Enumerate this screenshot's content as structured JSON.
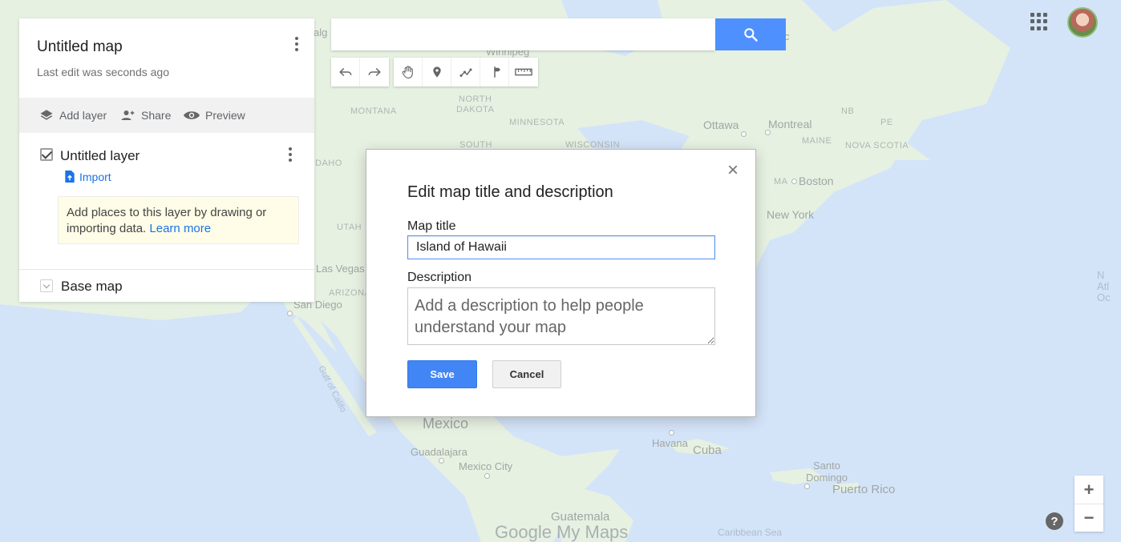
{
  "map": {
    "labels": {
      "winnipeg": "Winnipeg",
      "montana": "MONTANA",
      "north_dakota": "NORTH\nDAKOTA",
      "minnesota": "MINNESOTA",
      "south": "SOUTH",
      "wisconsin": "WISCONSIN",
      "idaho": "DAHO",
      "utah": "UTAH",
      "las_vegas": "Las Vegas",
      "arizona": "ARIZONA",
      "san_diego": "San Diego",
      "gulf_of_california": "Gulf of Califo",
      "mexico": "Mexico",
      "guadalajara": "Guadalajara",
      "mexico_city": "Mexico City",
      "guatemala": "Guatemala",
      "havana": "Havana",
      "cuba": "Cuba",
      "santo_domingo": "Santo\nDomingo",
      "puerto_rico": "Puerto Rico",
      "caribbean_sea": "Caribbean Sea",
      "ottawa": "Ottawa",
      "montreal": "Montreal",
      "maine": "MAINE",
      "nova_scotia": "NOVA SCOTIA",
      "nb": "NB",
      "pe": "PE",
      "boston": "Boston",
      "ma": "MA",
      "new_york": "New York",
      "north_atlantic": "N\nAtl\nOc",
      "alg": "alg",
      "c_fragment": "c"
    }
  },
  "left_panel": {
    "title": "Untitled map",
    "subtitle": "Last edit was seconds ago",
    "actions": {
      "add_layer": "Add layer",
      "share": "Share",
      "preview": "Preview"
    },
    "layer": {
      "title": "Untitled layer",
      "import_label": "Import",
      "hint_text": "Add places to this layer by drawing or importing data.",
      "learn_more": "Learn more"
    },
    "base_map": "Base map"
  },
  "search": {
    "placeholder": "",
    "value": ""
  },
  "brand": "Google My Maps",
  "zoom": {
    "in": "+",
    "out": "−"
  },
  "help": "?",
  "dialog": {
    "title": "Edit map title and description",
    "map_title_label": "Map title",
    "map_title_value": "Island of Hawaii",
    "description_label": "Description",
    "description_placeholder": "Add a description to help people understand your map",
    "save": "Save",
    "cancel": "Cancel",
    "close": "×"
  },
  "colors": {
    "accent": "#4285f4",
    "link": "#1a73e8",
    "water": "#a9c9f0",
    "land": "#cfe3c4"
  }
}
